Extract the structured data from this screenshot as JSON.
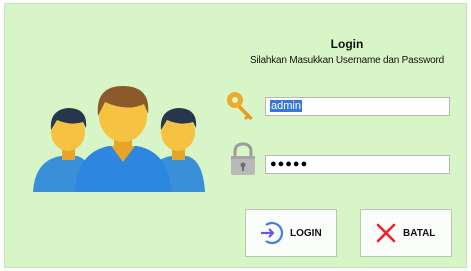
{
  "form": {
    "title": "Login",
    "subtitle": "Silahkan Masukkan Username dan Password",
    "username_value": "admin",
    "password_value": "●●●●●"
  },
  "buttons": {
    "login_label": "LOGIN",
    "cancel_label": "BATAL"
  },
  "icons": {
    "users": "users-group-icon",
    "key": "key-icon",
    "lock": "lock-icon",
    "login": "login-arrow-icon",
    "cancel": "close-x-icon"
  },
  "colors": {
    "background": "#d8f5c8",
    "selection": "#3478d8",
    "cancel_x": "#e8262b",
    "login_icon": "#3f7ee8"
  }
}
